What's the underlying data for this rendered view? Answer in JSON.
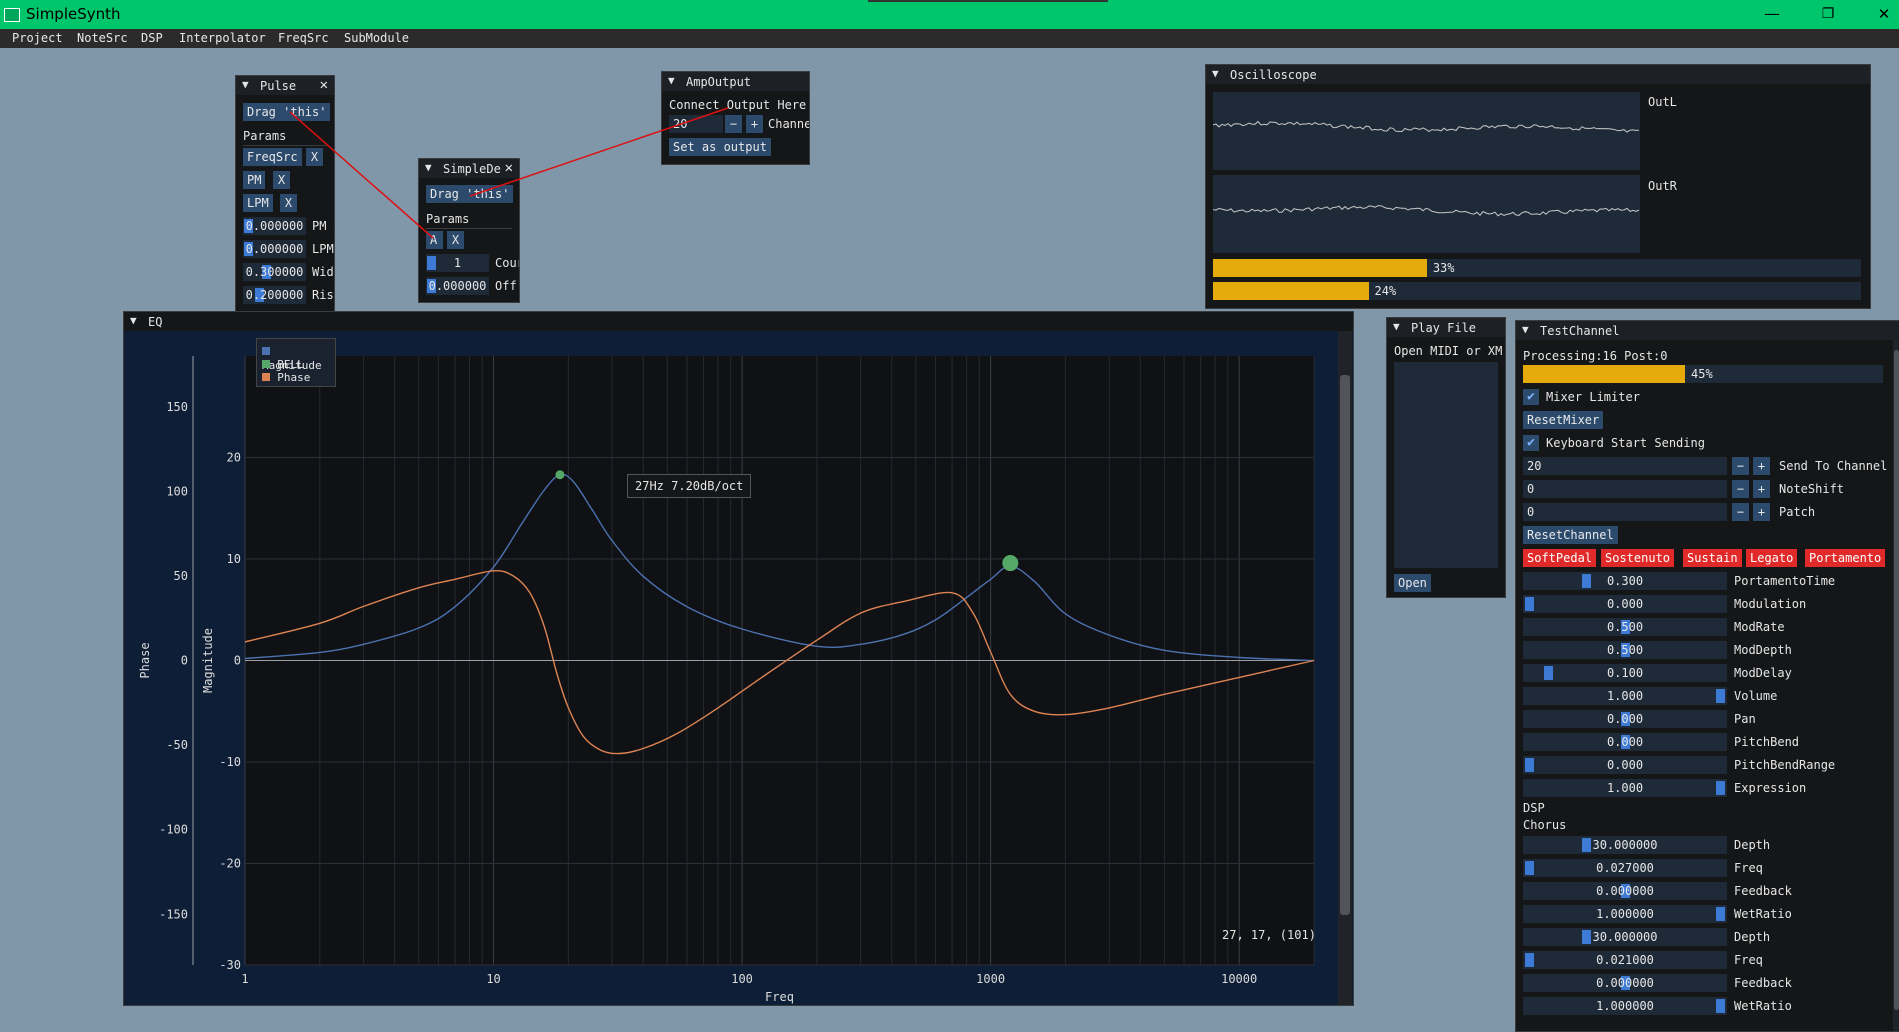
{
  "app": {
    "title": "SimpleSynth",
    "win_min": "—",
    "win_max": "❐",
    "win_close": "✕"
  },
  "menu": [
    "Project",
    "NoteSrc",
    "DSP",
    "Interpolator",
    "FreqSrc",
    "SubModule"
  ],
  "pulse": {
    "title": "Pulse",
    "close": "✕",
    "drag": "Drag 'this'",
    "params": "Params",
    "params_list": [
      {
        "name": "FreqSrc",
        "x": "X"
      },
      {
        "name": "PM",
        "x": "X"
      },
      {
        "name": "LPM",
        "x": "X"
      }
    ],
    "fields": [
      {
        "value": "0.000000",
        "label": "PM A"
      },
      {
        "value": "0.000000",
        "label": "LPM"
      },
      {
        "value": "0.300000",
        "label": "Wid"
      },
      {
        "value": "0.200000",
        "label": "Ris"
      }
    ]
  },
  "simpledelay": {
    "title": "SimpleDe",
    "close": "✕",
    "drag": "Drag 'this'",
    "params": "Params",
    "param_a": "A",
    "param_x": "X",
    "fields": [
      {
        "value": "1",
        "label": "Cour"
      },
      {
        "value": "0.000000",
        "label": "Off:"
      }
    ]
  },
  "ampoutput": {
    "title": "AmpOutput",
    "connect": "Connect Output Here",
    "channel_value": "20",
    "minus": "−",
    "plus": "+",
    "channel_label": "Channe",
    "set_output": "Set as output"
  },
  "oscilloscope": {
    "title": "Oscilloscope",
    "labels": [
      "OutL",
      "OutR"
    ],
    "bars": [
      {
        "fraction": 0.33,
        "text": "33%"
      },
      {
        "fraction": 0.24,
        "text": "24%"
      }
    ]
  },
  "eq": {
    "title": "EQ",
    "legend": [
      {
        "name": "Magnitude",
        "color": "#4c72b0"
      },
      {
        "name": "BELL",
        "color": "#55a868"
      },
      {
        "name": "Phase",
        "color": "#dd8452"
      }
    ],
    "tooltip": "27Hz 7.20dB/oct",
    "cursor_readout": "27, 17, (101)"
  },
  "chart_data": {
    "type": "line",
    "xlabel": "Freq",
    "ylabel": "Magnitude",
    "y2label": "Phase",
    "x_scale": "log",
    "xlim": [
      1,
      20000
    ],
    "ylim": [
      -30,
      30
    ],
    "y2lim": [
      -180,
      180
    ],
    "x_ticks": [
      "1",
      "10",
      "100",
      "1000",
      "10000"
    ],
    "x_tick_values": [
      1,
      10,
      100,
      1000,
      10000
    ],
    "y_ticks": [
      "20",
      "10",
      "0",
      "-10",
      "-20",
      "-30"
    ],
    "y_tick_values": [
      20,
      10,
      0,
      -10,
      -20,
      -30
    ],
    "y2_ticks": [
      "150",
      "100",
      "50",
      "0",
      "-50",
      "-100",
      "-150"
    ],
    "y2_tick_values": [
      150,
      100,
      50,
      0,
      -50,
      -100,
      -150
    ],
    "grid": true,
    "legend_position": "top-left",
    "series": [
      {
        "name": "Magnitude",
        "color": "#4c72b0",
        "axis": "left",
        "x": [
          1,
          2,
          3,
          5,
          7,
          10,
          13,
          16,
          18.5,
          21,
          25,
          30,
          40,
          60,
          100,
          200,
          300,
          450,
          600,
          800,
          1000,
          1200,
          1500,
          2000,
          3000,
          5000,
          10000,
          20000
        ],
        "y": [
          0.2,
          0.8,
          1.6,
          3.2,
          5.3,
          9.2,
          13.5,
          16.8,
          18.3,
          17.6,
          14.8,
          11.8,
          8.3,
          5.3,
          3.1,
          1.4,
          1.6,
          2.6,
          4,
          6.2,
          8,
          9.3,
          7.8,
          4.6,
          2.5,
          1,
          0.3,
          0
        ]
      },
      {
        "name": "Phase",
        "color": "#dd8452",
        "axis": "right",
        "x": [
          1,
          2,
          3,
          5,
          7,
          10,
          12,
          14,
          16,
          18,
          20,
          23,
          27,
          32,
          40,
          55,
          80,
          120,
          200,
          300,
          450,
          700,
          850,
          1000,
          1200,
          1500,
          2000,
          3000,
          5000,
          10000,
          20000
        ],
        "y": [
          11,
          22,
          32,
          43,
          48,
          53,
          50,
          40,
          20,
          -8,
          -28,
          -45,
          -53,
          -55,
          -52,
          -43,
          -28,
          -10,
          12,
          28,
          35,
          40,
          28,
          5,
          -20,
          -30,
          -32,
          -28,
          -20,
          -10,
          0
        ]
      }
    ],
    "points": [
      {
        "name": "BELL",
        "x": 18.5,
        "y": 18.3,
        "color": "#55a868",
        "size": "small"
      },
      {
        "name": "BELL",
        "x": 1200,
        "y": 9.6,
        "color": "#55a868",
        "size": "large"
      }
    ]
  },
  "playfile": {
    "title": "Play File",
    "open_label": "Open MIDI or XM",
    "open_btn": "Open"
  },
  "testchannel": {
    "title": "TestChannel",
    "processing": "Processing:16 Post:0",
    "progress": {
      "fraction": 0.45,
      "text": "45%"
    },
    "check_mark": "✔",
    "mixer_limiter": "Mixer Limiter",
    "reset_mixer": "ResetMixer",
    "keyboard_start": "Keyboard Start Sending",
    "steppers": [
      {
        "value": "20",
        "label": "Send To Channel"
      },
      {
        "value": "0",
        "label": "NoteShift"
      },
      {
        "value": "0",
        "label": "Patch"
      }
    ],
    "minus": "−",
    "plus": "+",
    "reset_channel": "ResetChannel",
    "pedals": [
      "SoftPedal",
      "Sostenuto",
      "Sustain",
      "Legato",
      "Portamento"
    ],
    "sliders": [
      {
        "value": "0.300",
        "label": "PortamentoTime",
        "fraction": 0.3
      },
      {
        "value": "0.000",
        "label": "Modulation",
        "fraction": 0.0
      },
      {
        "value": "0.500",
        "label": "ModRate",
        "fraction": 0.5
      },
      {
        "value": "0.500",
        "label": "ModDepth",
        "fraction": 0.5
      },
      {
        "value": "0.100",
        "label": "ModDelay",
        "fraction": 0.1
      },
      {
        "value": "1.000",
        "label": "Volume",
        "fraction": 1.0
      },
      {
        "value": "0.000",
        "label": "Pan",
        "fraction": 0.5
      },
      {
        "value": "0.000",
        "label": "PitchBend",
        "fraction": 0.5
      },
      {
        "value": "0.000",
        "label": "PitchBendRange",
        "fraction": 0.0
      },
      {
        "value": "1.000",
        "label": "Expression",
        "fraction": 1.0
      }
    ],
    "dsp": "DSP",
    "chorus": "Chorus",
    "chorus_sliders": [
      {
        "value": "30.000000",
        "label": "Depth",
        "fraction": 0.3
      },
      {
        "value": "0.027000",
        "label": "Freq",
        "fraction": 0.0
      },
      {
        "value": "0.000000",
        "label": "Feedback",
        "fraction": 0.5
      },
      {
        "value": "1.000000",
        "label": "WetRatio",
        "fraction": 1.0
      },
      {
        "value": "30.000000",
        "label": "Depth",
        "fraction": 0.3
      },
      {
        "value": "0.021000",
        "label": "Freq",
        "fraction": 0.0
      },
      {
        "value": "0.000000",
        "label": "Feedback",
        "fraction": 0.5
      },
      {
        "value": "1.000000",
        "label": "WetRatio",
        "fraction": 1.0
      }
    ]
  }
}
